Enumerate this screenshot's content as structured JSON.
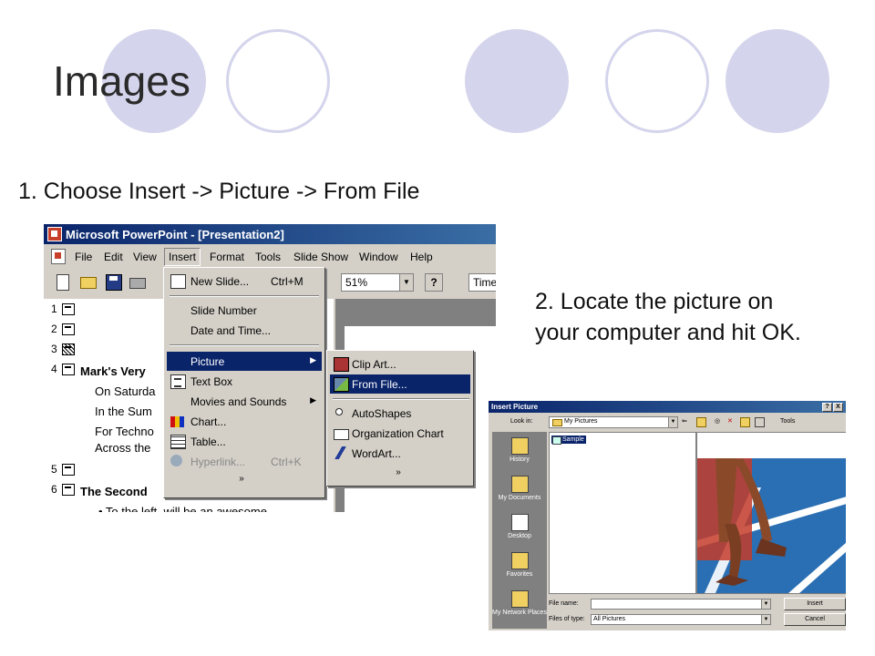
{
  "slide": {
    "title": "Images",
    "step1": "1. Choose Insert -> Picture -> From File",
    "step2": "2. Locate the picture on your computer and hit OK.",
    "decor_color": "#d4d4ec"
  },
  "powerpoint": {
    "title_bar": "Microsoft PowerPoint - [Presentation2]",
    "menu": [
      "File",
      "Edit",
      "View",
      "Insert",
      "Format",
      "Tools",
      "Slide Show",
      "Window",
      "Help"
    ],
    "zoom": "51%",
    "font": "Time",
    "outline": {
      "numbers": [
        "1",
        "2",
        "3",
        "4",
        "5",
        "6"
      ],
      "slide4_title": "Mark's Very",
      "slide4_lines": [
        "On Saturda",
        "In the Sum",
        "For Techno",
        "Across the"
      ],
      "slide6_title": "The Second",
      "slide6_line": "• To the left, will be an awesome"
    },
    "insert_menu": [
      {
        "label": "New Slide...",
        "shortcut": "Ctrl+M",
        "icon": "new-slide-icon"
      },
      {
        "label": "Slide Number",
        "shortcut": ""
      },
      {
        "label": "Date and Time...",
        "shortcut": ""
      },
      {
        "label": "Picture",
        "shortcut": "",
        "submenu": true
      },
      {
        "label": "Text Box",
        "shortcut": "",
        "icon": "text-box-icon"
      },
      {
        "label": "Movies and Sounds",
        "shortcut": "",
        "submenu": true
      },
      {
        "label": "Chart...",
        "shortcut": "",
        "icon": "chart-icon"
      },
      {
        "label": "Table...",
        "shortcut": "",
        "icon": "table-icon"
      },
      {
        "label": "Hyperlink...",
        "shortcut": "Ctrl+K",
        "icon": "hyperlink-icon",
        "disabled": true
      }
    ],
    "picture_submenu": [
      "Clip Art...",
      "From File...",
      "AutoShapes",
      "Organization Chart",
      "WordArt..."
    ],
    "expand_glyph": "»",
    "highlight_color": "#0a246a"
  },
  "dialog": {
    "title": "Insert Picture",
    "help": "?",
    "close": "X",
    "look_in_label": "Look in:",
    "look_in_value": "My Pictures",
    "tools": "Tools",
    "places": [
      "History",
      "My Documents",
      "Desktop",
      "Favorites",
      "My Network Places"
    ],
    "files": [
      "Sample"
    ],
    "file_name_label": "File name:",
    "file_name_value": "",
    "files_of_type_label": "Files of type:",
    "files_of_type_value": "All Pictures",
    "insert_button": "Insert",
    "cancel_button": "Cancel",
    "preview_colors": {
      "track": "#2a6fb3",
      "lines": "#ffffff",
      "skin": "#8a4a2a"
    }
  }
}
